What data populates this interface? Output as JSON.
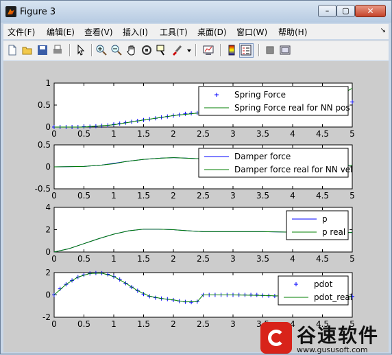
{
  "window": {
    "title": "Figure 3",
    "minimize": "–",
    "maximize": "▢",
    "close": "✕"
  },
  "menu": [
    "文件(F)",
    "编辑(E)",
    "查看(V)",
    "插入(I)",
    "工具(T)",
    "桌面(D)",
    "窗口(W)",
    "帮助(H)"
  ],
  "menu_overflow": "↘",
  "toolbar": [
    "new-figure-icon",
    "open-file-icon",
    "save-icon",
    "print-icon",
    "edit-plot-arrow-icon",
    "zoom-in-icon",
    "zoom-out-icon",
    "pan-hand-icon",
    "rotate-3d-icon",
    "data-cursor-icon",
    "brush-icon",
    "brush-dropdown-icon",
    "link-plot-icon",
    "insert-colorbar-icon",
    "insert-legend-icon",
    "hide-plot-tools-icon",
    "show-plot-tools-icon"
  ],
  "colors": {
    "blue": "#0000ff",
    "green": "#007f00",
    "figure_bg": "#cccccc"
  },
  "chart_data": [
    {
      "type": "line",
      "xlim": [
        0,
        5
      ],
      "ylim": [
        0,
        1
      ],
      "xticks": [
        "0",
        "0.5",
        "1",
        "1.5",
        "2",
        "2.5",
        "3",
        "3.5",
        "4",
        "4.5",
        "5"
      ],
      "yticks": [
        "0",
        "0.5",
        "1"
      ],
      "legend_position": "top-right",
      "series": [
        {
          "name": "Spring Force",
          "color": "#0000ff",
          "marker": "+",
          "line": false,
          "x": [
            0,
            0.1,
            0.2,
            0.3,
            0.4,
            0.5,
            0.6,
            0.7,
            0.8,
            0.9,
            1,
            1.1,
            1.2,
            1.3,
            1.4,
            1.5,
            1.6,
            1.7,
            1.8,
            1.9,
            2,
            2.1,
            2.2,
            2.3,
            2.4,
            2.5,
            2.6,
            2.7,
            2.8,
            2.9,
            3,
            3.1,
            3.2,
            3.3,
            3.4,
            3.5,
            3.6,
            3.7,
            3.8,
            3.9,
            4,
            4.1,
            4.2,
            4.3,
            4.4,
            4.5,
            4.6,
            4.7,
            4.8,
            4.9,
            5
          ],
          "y": [
            0,
            0,
            0,
            0,
            0,
            0.01,
            0.01,
            0.02,
            0.03,
            0.04,
            0.06,
            0.08,
            0.1,
            0.12,
            0.14,
            0.16,
            0.18,
            0.2,
            0.22,
            0.24,
            0.26,
            0.28,
            0.3,
            0.31,
            0.32,
            0.33,
            0.34,
            0.35,
            0.36,
            0.37,
            0.38,
            0.39,
            0.4,
            0.41,
            0.42,
            0.43,
            0.44,
            0.45,
            0.46,
            0.47,
            0.48,
            0.49,
            0.5,
            0.51,
            0.52,
            0.53,
            0.54,
            0.55,
            0.56,
            0.57,
            0.57
          ]
        },
        {
          "name": "Spring Force real for NN pos",
          "color": "#007f00",
          "marker": "",
          "line": true,
          "x": [
            0,
            0.5,
            1,
            1.5,
            2,
            2.5,
            3,
            3.5,
            4,
            4.5,
            5
          ],
          "y": [
            0,
            0,
            0.05,
            0.16,
            0.26,
            0.33,
            0.38,
            0.43,
            0.48,
            0.53,
            0.88
          ]
        }
      ]
    },
    {
      "type": "line",
      "xlim": [
        0,
        5
      ],
      "ylim": [
        -0.5,
        0.5
      ],
      "xticks": [
        "0",
        "0.5",
        "1",
        "1.5",
        "2",
        "2.5",
        "3",
        "3.5",
        "4",
        "4.5",
        "5"
      ],
      "yticks": [
        "-0.5",
        "0",
        "0.5"
      ],
      "legend_position": "top-right",
      "series": [
        {
          "name": "Damper force",
          "color": "#0000ff",
          "marker": "",
          "line": true,
          "x": [
            0,
            0.5,
            0.8,
            1,
            1.2,
            1.5,
            1.8,
            2,
            2.2,
            2.5,
            2.8,
            3,
            3.5,
            4,
            4.5,
            5
          ],
          "y": [
            0,
            0.01,
            0.04,
            0.08,
            0.12,
            0.17,
            0.2,
            0.21,
            0.2,
            0.18,
            0.16,
            0.15,
            0.12,
            0.1,
            0.07,
            0.03
          ]
        },
        {
          "name": "Damper force real for NN vel",
          "color": "#007f00",
          "marker": "",
          "line": true,
          "x": [
            0,
            0.5,
            0.8,
            1,
            1.2,
            1.5,
            1.8,
            2,
            2.2,
            2.5,
            2.8,
            3,
            3.5,
            4,
            4.5,
            5
          ],
          "y": [
            0,
            0.01,
            0.04,
            0.07,
            0.12,
            0.17,
            0.2,
            0.21,
            0.2,
            0.18,
            0.16,
            0.15,
            0.12,
            0.1,
            0.07,
            0.03
          ]
        }
      ]
    },
    {
      "type": "line",
      "xlim": [
        0,
        5
      ],
      "ylim": [
        0,
        4
      ],
      "xticks": [
        "0",
        "0.5",
        "1",
        "1.5",
        "2",
        "2.5",
        "3",
        "3.5",
        "4",
        "4.5",
        "5"
      ],
      "yticks": [
        "0",
        "2",
        "4"
      ],
      "legend_position": "top-right",
      "series": [
        {
          "name": "p",
          "color": "#0000ff",
          "marker": "",
          "line": true,
          "x": [
            0,
            0.25,
            0.5,
            0.75,
            1,
            1.25,
            1.5,
            1.75,
            2,
            2.25,
            2.5,
            3,
            3.5,
            4,
            4.5,
            5
          ],
          "y": [
            0,
            0.3,
            0.75,
            1.2,
            1.6,
            1.9,
            2.05,
            2.05,
            2,
            1.9,
            1.82,
            1.82,
            1.82,
            1.78,
            1.75,
            1.75
          ]
        },
        {
          "name": "p real",
          "color": "#007f00",
          "marker": "",
          "line": true,
          "x": [
            0,
            0.25,
            0.5,
            0.75,
            1,
            1.25,
            1.5,
            1.75,
            2,
            2.25,
            2.5,
            3,
            3.5,
            4,
            4.5,
            5
          ],
          "y": [
            0,
            0.3,
            0.75,
            1.2,
            1.6,
            1.9,
            2.05,
            2.05,
            2,
            1.9,
            1.82,
            1.82,
            1.82,
            1.78,
            1.75,
            1.75
          ]
        }
      ]
    },
    {
      "type": "line",
      "xlim": [
        0,
        5
      ],
      "ylim": [
        -2,
        2
      ],
      "xticks": [
        "0",
        "0.5",
        "1",
        "1.5",
        "2",
        "2.5",
        "3",
        "3.5",
        "4",
        "4.5",
        "5"
      ],
      "yticks": [
        "-2",
        "0",
        "2"
      ],
      "legend_position": "top-right",
      "series": [
        {
          "name": "pdot",
          "color": "#0000ff",
          "marker": "+",
          "line": false,
          "x": [
            0,
            0.1,
            0.2,
            0.3,
            0.4,
            0.5,
            0.6,
            0.7,
            0.8,
            0.9,
            1,
            1.1,
            1.2,
            1.3,
            1.4,
            1.5,
            1.6,
            1.7,
            1.8,
            1.9,
            2,
            2.1,
            2.2,
            2.3,
            2.4,
            2.5,
            2.6,
            2.7,
            2.8,
            2.9,
            3,
            3.1,
            3.2,
            3.3,
            3.4,
            3.5,
            3.6,
            3.7,
            3.8,
            3.9,
            4,
            4.1,
            4.2,
            4.3,
            4.4,
            4.5,
            4.6,
            4.7,
            4.8,
            4.9,
            5
          ],
          "y": [
            0,
            0.55,
            0.95,
            1.3,
            1.6,
            1.8,
            1.92,
            1.96,
            1.95,
            1.85,
            1.65,
            1.38,
            1.05,
            0.7,
            0.38,
            0.08,
            -0.12,
            -0.25,
            -0.32,
            -0.38,
            -0.45,
            -0.55,
            -0.62,
            -0.65,
            -0.6,
            0,
            0,
            0,
            0,
            0,
            0,
            0,
            0,
            0,
            0,
            -0.05,
            -0.08,
            -0.1,
            -0.12,
            -0.13,
            -0.14,
            -0.14,
            -0.14,
            -0.14,
            -0.14,
            -0.14,
            -0.14,
            -0.14,
            -0.14,
            -0.14,
            -0.14
          ]
        },
        {
          "name": "pdot_real",
          "color": "#007f00",
          "marker": "",
          "line": true,
          "x": [
            0,
            0.2,
            0.4,
            0.6,
            0.8,
            1,
            1.2,
            1.4,
            1.6,
            1.8,
            2,
            2.2,
            2.4,
            2.5,
            3,
            3.5,
            4,
            4.5,
            5
          ],
          "y": [
            0,
            0.95,
            1.6,
            1.92,
            1.95,
            1.65,
            1.05,
            0.38,
            -0.12,
            -0.32,
            -0.45,
            -0.62,
            -0.6,
            0,
            0,
            -0.05,
            -0.13,
            -0.14,
            -0.14
          ]
        }
      ]
    }
  ],
  "watermark": {
    "name": "谷速软件",
    "url": "www.gususoft.com"
  }
}
